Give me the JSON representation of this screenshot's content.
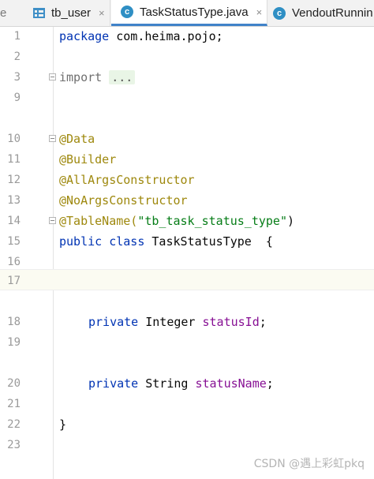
{
  "tabs": {
    "cut_label": "e",
    "tb_user": "tb_user",
    "task_status": "TaskStatusType.java",
    "vendout": "VendoutRunnin",
    "close_glyph": "×",
    "class_glyph": "c"
  },
  "gutter": {
    "lines": [
      "1",
      "2",
      "3",
      "9",
      "10",
      "11",
      "12",
      "13",
      "14",
      "15",
      "16",
      "17",
      "18",
      "19",
      "20",
      "21",
      "22",
      "23"
    ]
  },
  "code": {
    "l1_kw": "package",
    "l1_rest": " com.heima.pojo;",
    "l3_kw": "import",
    "l3_dots": "...",
    "l10": "@Data",
    "l11": "@Builder",
    "l12": "@AllArgsConstructor",
    "l13": "@NoArgsConstructor",
    "l14_ann": "@TableName(",
    "l14_str": "\"tb_task_status_type\"",
    "l14_close": ")",
    "l15_kw": "public class",
    "l15_rest": " TaskStatusType  {",
    "l18_kw": "private",
    "l18_type": " Integer ",
    "l18_field": "statusId",
    "l18_semi": ";",
    "l20_kw": "private",
    "l20_type": " String ",
    "l20_field": "statusName",
    "l20_semi": ";",
    "l22": "}"
  },
  "watermark": "CSDN @遇上彩虹pkq"
}
